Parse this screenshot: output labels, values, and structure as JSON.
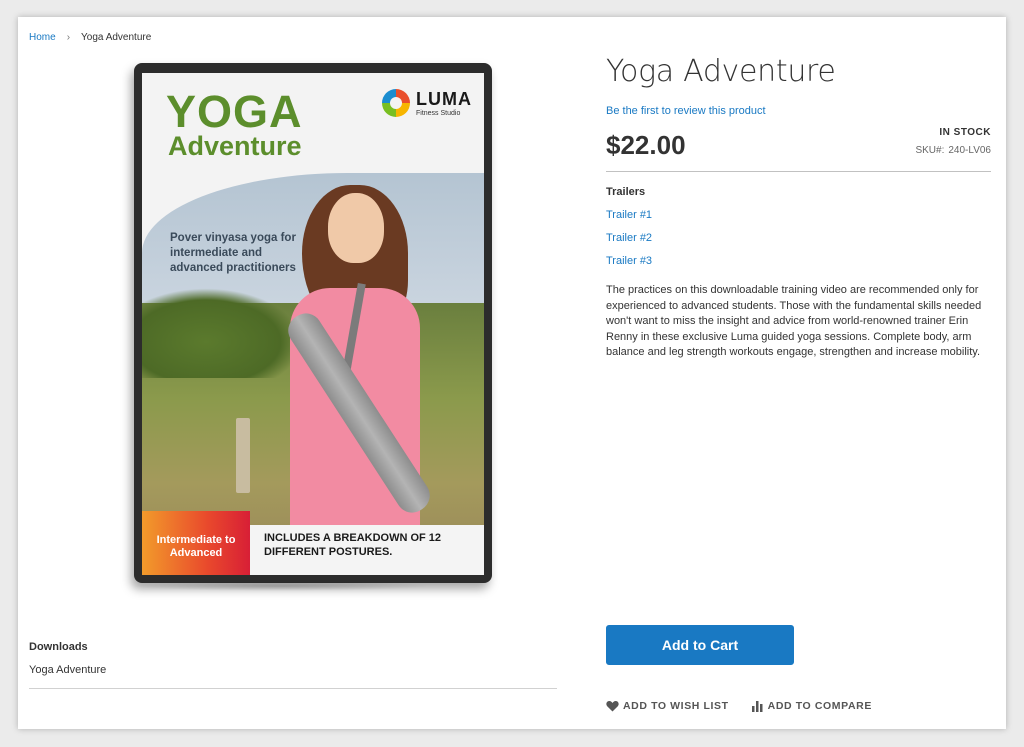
{
  "breadcrumb": {
    "home": "Home",
    "separator": "›",
    "current": "Yoga Adventure"
  },
  "cover": {
    "title_line1": "YOGA",
    "title_line2": "Adventure",
    "brand": "LUMA",
    "brand_sub": "Fitness Studio",
    "tagline": "Pover vinyasa yoga for intermediate and advanced practitioners",
    "badge": "Intermediate to Advanced",
    "breakdown": "INCLUDES A BREAKDOWN OF 12 DIFFERENT POSTURES.",
    "colors": {
      "title_green": "#5c8e2c",
      "badge_orange": "#f29b2b",
      "badge_red": "#d81f36"
    }
  },
  "product": {
    "title": "Yoga Adventure",
    "review_link": "Be the first to review this product",
    "price": "$22.00",
    "stock": "IN STOCK",
    "sku_label": "SKU#:",
    "sku_value": "240-LV06",
    "trailers_title": "Trailers",
    "trailers": [
      "Trailer #1",
      "Trailer #2",
      "Trailer #3"
    ],
    "description": "The practices on this downloadable training video are recommended only for experienced to advanced students. Those with the fundamental skills needed won't want to miss the insight and advice from world-renowned trainer Erin Renny in these exclusive Luma guided yoga sessions. Complete body, arm balance and leg strength workouts engage, strengthen and increase mobility."
  },
  "actions": {
    "add_to_cart": "Add to Cart",
    "wishlist": "ADD TO WISH LIST",
    "compare": "ADD TO COMPARE",
    "wishlist_icon": "heart-icon",
    "compare_icon": "bar-chart-icon"
  },
  "downloads": {
    "title": "Downloads",
    "item": "Yoga Adventure"
  },
  "colors": {
    "link": "#1979c3",
    "button": "#1979c3",
    "text": "#333333"
  }
}
